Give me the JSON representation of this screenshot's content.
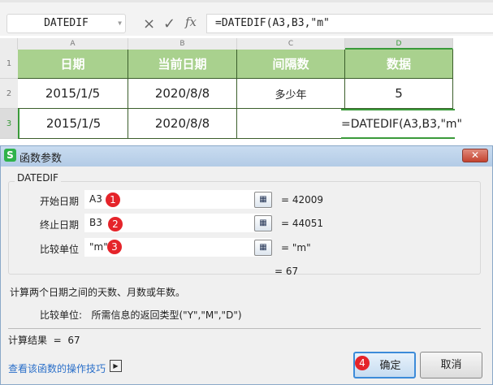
{
  "formula_bar": {
    "name_box": "DATEDIF",
    "cancel_icon": "×",
    "confirm_icon": "✓",
    "fx_label": "fx",
    "formula": "=DATEDIF(A3,B3,\"m\""
  },
  "columns": [
    "A",
    "B",
    "C",
    "D"
  ],
  "rows": [
    "1",
    "2",
    "3"
  ],
  "cells": {
    "r1": [
      "日期",
      "当前日期",
      "间隔数",
      "数据"
    ],
    "r2": [
      "2015/1/5",
      "2020/8/8",
      "多少年",
      "5"
    ],
    "r3": [
      "2015/1/5",
      "2020/8/8",
      "",
      "=DATEDIF(A3,B3,\"m\""
    ]
  },
  "dialog": {
    "title": "函数参数",
    "app_icon": "S",
    "close": "✕",
    "function_name": "DATEDIF",
    "args": [
      {
        "label": "开始日期",
        "value": "A3",
        "badge": "1",
        "result": "= 42009"
      },
      {
        "label": "终止日期",
        "value": "B3",
        "badge": "2",
        "result": "= 44051"
      },
      {
        "label": "比较单位",
        "value": "\"m\"",
        "badge": "3",
        "result": "= \"m\""
      }
    ],
    "formula_result": "= 67",
    "description": "计算两个日期之间的天数、月数或年数。",
    "arg_help": "比较单位:   所需信息的返回类型(\"Y\",\"M\",\"D\")",
    "calc_result": "计算结果  =  67",
    "help_link": "查看该函数的操作技巧",
    "ok_badge": "4",
    "ok": "确定",
    "cancel": "取消"
  }
}
